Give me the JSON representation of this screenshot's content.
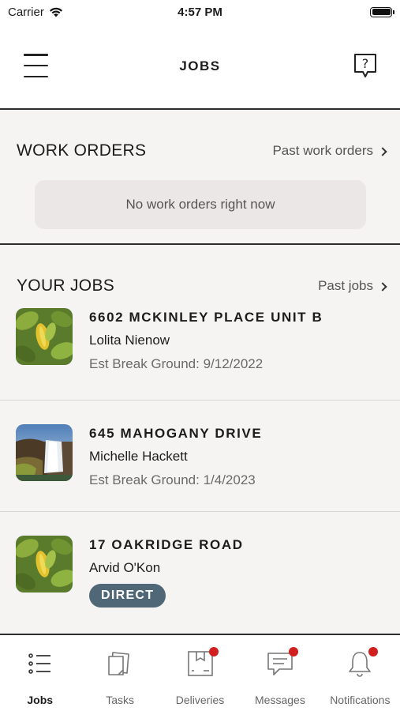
{
  "status_bar": {
    "carrier": "Carrier",
    "time": "4:57 PM"
  },
  "header": {
    "title": "JOBS",
    "menu_icon": "hamburger-menu-icon",
    "help_icon": "help-speech-bubble-icon"
  },
  "work_orders": {
    "title": "WORK ORDERS",
    "past_link": "Past work orders",
    "empty_message": "No work orders right now"
  },
  "jobs": {
    "title": "YOUR JOBS",
    "past_link": "Past jobs",
    "items": [
      {
        "address": "6602 MCKINLEY PLACE UNIT B",
        "name": "Lolita Nienow",
        "date": "Est Break Ground: 9/12/2022",
        "thumbnail": "leaf-photo"
      },
      {
        "address": "645 MAHOGANY DRIVE",
        "name": "Michelle Hackett",
        "date": "Est Break Ground: 1/4/2023",
        "thumbnail": "waterfall-photo"
      },
      {
        "address": "17 OAKRIDGE ROAD",
        "name": "Arvid O'Kon",
        "badge": "DIRECT",
        "thumbnail": "leaf-photo"
      }
    ]
  },
  "tab_bar": {
    "tabs": [
      {
        "label": "Jobs",
        "icon": "list-icon",
        "active": true,
        "badge": false
      },
      {
        "label": "Tasks",
        "icon": "notes-icon",
        "active": false,
        "badge": false
      },
      {
        "label": "Deliveries",
        "icon": "box-icon",
        "active": false,
        "badge": true
      },
      {
        "label": "Messages",
        "icon": "chat-bubble-icon",
        "active": false,
        "badge": true
      },
      {
        "label": "Notifications",
        "icon": "bell-icon",
        "active": false,
        "badge": true
      }
    ]
  },
  "colors": {
    "badge_dot": "#d11f1f",
    "direct_badge": "#4f6777",
    "content_bg": "#f5f4f2",
    "empty_box": "#ebe7e6"
  }
}
